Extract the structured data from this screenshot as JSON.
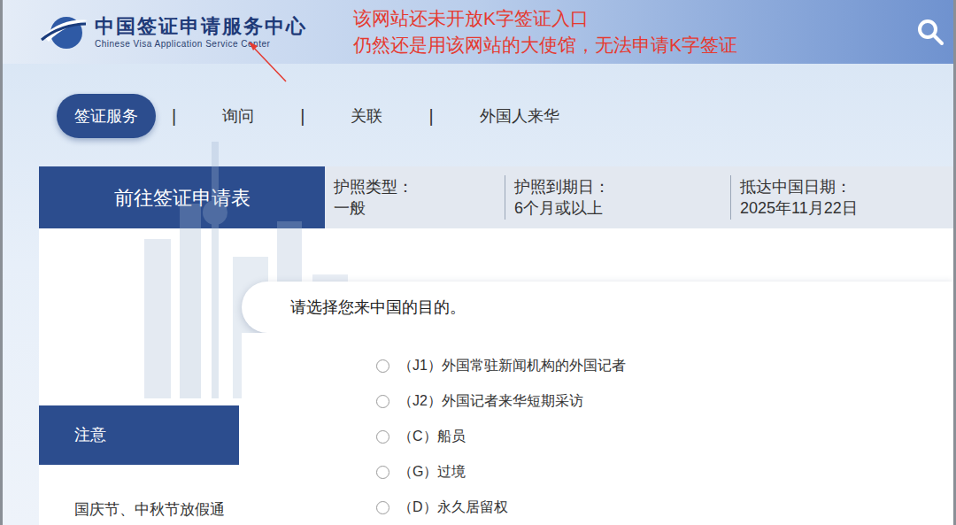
{
  "header": {
    "logo_cn": "中国签证申请服务中心",
    "logo_en": "Chinese Visa Application Service Center"
  },
  "annotation": {
    "lines": [
      "该网站还未开放K字签证入口",
      "仍然还是用该网站的大使馆，无法申请K字签证"
    ]
  },
  "nav": {
    "separator": "|",
    "items": [
      {
        "label": "签证服务",
        "selected": true
      },
      {
        "label": "询问",
        "selected": false
      },
      {
        "label": "关联",
        "selected": false
      },
      {
        "label": "外国人来华",
        "selected": false
      }
    ]
  },
  "application": {
    "button": "前往签证申请表",
    "fields": [
      {
        "label": "护照类型：",
        "value": "一般"
      },
      {
        "label": "护照到期日：",
        "value": "6个月或以上"
      },
      {
        "label": "抵达中国日期：",
        "value": "2025年11月22日"
      }
    ]
  },
  "notice": {
    "title": "注意",
    "text": "国庆节、中秋节放假通"
  },
  "purpose": {
    "prompt": "请选择您来中国的目的。",
    "options": [
      {
        "label": "（J1）外国常驻新闻机构的外国记者",
        "selected": false
      },
      {
        "label": "（J2）外国记者来华短期采访",
        "selected": false
      },
      {
        "label": "（C）船员",
        "selected": false
      },
      {
        "label": "（G）过境",
        "selected": false
      },
      {
        "label": "（D）永久居留权",
        "selected": false
      }
    ]
  }
}
